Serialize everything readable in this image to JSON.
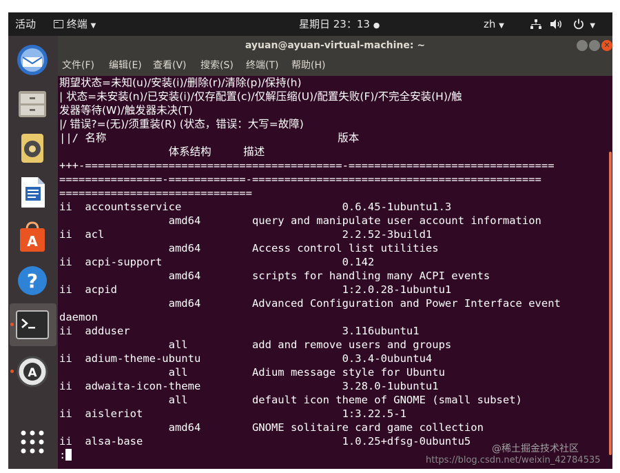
{
  "topbar": {
    "activities": "活动",
    "app_menu": "终端",
    "clock": "星期日 23：13",
    "input_method": "zh"
  },
  "window": {
    "title": "ayuan@ayuan-virtual-machine: ~",
    "menu": [
      "文件(F)",
      "编辑(E)",
      "查看(V)",
      "搜索(S)",
      "终端(T)",
      "帮助(H)"
    ]
  },
  "terminal": {
    "lines": [
      "期望状态=未知(u)/安装(i)/删除(r)/清除(p)/保持(h)",
      "| 状态=未安装(n)/已安装(i)/仅存配置(c)/仅解压缩(U)/配置失败(F)/不完全安装(H)/触",
      "发器等待(W)/触发器未决(T)",
      "|/ 错误?=(无)/须重装(R) (状态，错误：大写=故障)",
      "||/ 名称                                    版本",
      "                 体系结构     描述",
      "+++-========================================-================================",
      "================-============-=============================================",
      "==============================",
      "ii  accountsservice                         0.6.45-1ubuntu1.3",
      "                 amd64        query and manipulate user account information",
      "ii  acl                                     2.2.52-3build1",
      "                 amd64        Access control list utilities",
      "ii  acpi-support                            0.142",
      "                 amd64        scripts for handling many ACPI events",
      "ii  acpid                                   1:2.0.28-1ubuntu1",
      "                 amd64        Advanced Configuration and Power Interface event",
      "daemon",
      "ii  adduser                                 3.116ubuntu1",
      "                 all          add and remove users and groups",
      "ii  adium-theme-ubuntu                      0.3.4-0ubuntu4",
      "                 all          Adium message style for Ubuntu",
      "ii  adwaita-icon-theme                      3.28.0-1ubuntu1",
      "                 all          default icon theme of GNOME (small subset)",
      "ii  aisleriot                               1:3.22.5-1",
      "                 amd64        GNOME solitaire card game collection",
      "ii  alsa-base                               1.0.25+dfsg-0ubuntu5"
    ],
    "prompt": ":"
  },
  "watermark": {
    "site": "@稀土掘金技术社区",
    "url": "https://blog.csdn.net/weixin_42784535"
  },
  "colors": {
    "terminal_bg": "#300a24",
    "accent": "#e95420"
  }
}
